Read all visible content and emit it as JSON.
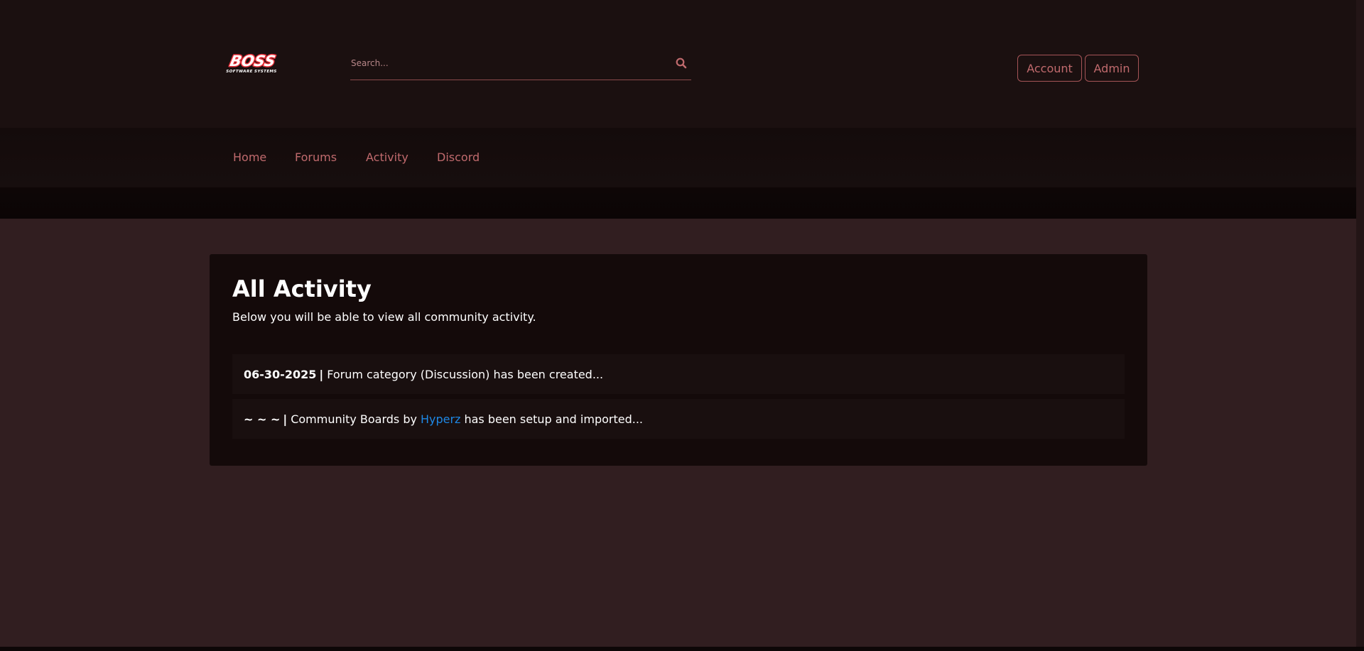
{
  "header": {
    "logo": {
      "text": "BOSS",
      "subtext": "SOFTWARE SYSTEMS",
      "color": "#e8313a"
    },
    "search": {
      "placeholder": "Search...",
      "value": ""
    },
    "buttons": {
      "account": "Account",
      "admin": "Admin"
    }
  },
  "nav": {
    "items": [
      {
        "label": "Home"
      },
      {
        "label": "Forums"
      },
      {
        "label": "Activity"
      },
      {
        "label": "Discord"
      }
    ]
  },
  "main": {
    "title": "All Activity",
    "subtitle": "Below you will be able to view all community activity.",
    "activities": [
      {
        "stamp": "06-30-2025",
        "separator": "|",
        "text": "Forum category (Discussion) has been created..."
      },
      {
        "stamp": "~ ~ ~",
        "separator": "|",
        "text_before": "Community Boards by",
        "link": "Hyperz",
        "text_after": "has been setup and imported..."
      }
    ]
  },
  "colors": {
    "accent": "#c06a6d",
    "link": "#1e88e5",
    "page_bg": "#311e20",
    "card_bg": "#140a0a"
  },
  "icons": {
    "search": "search-icon"
  }
}
